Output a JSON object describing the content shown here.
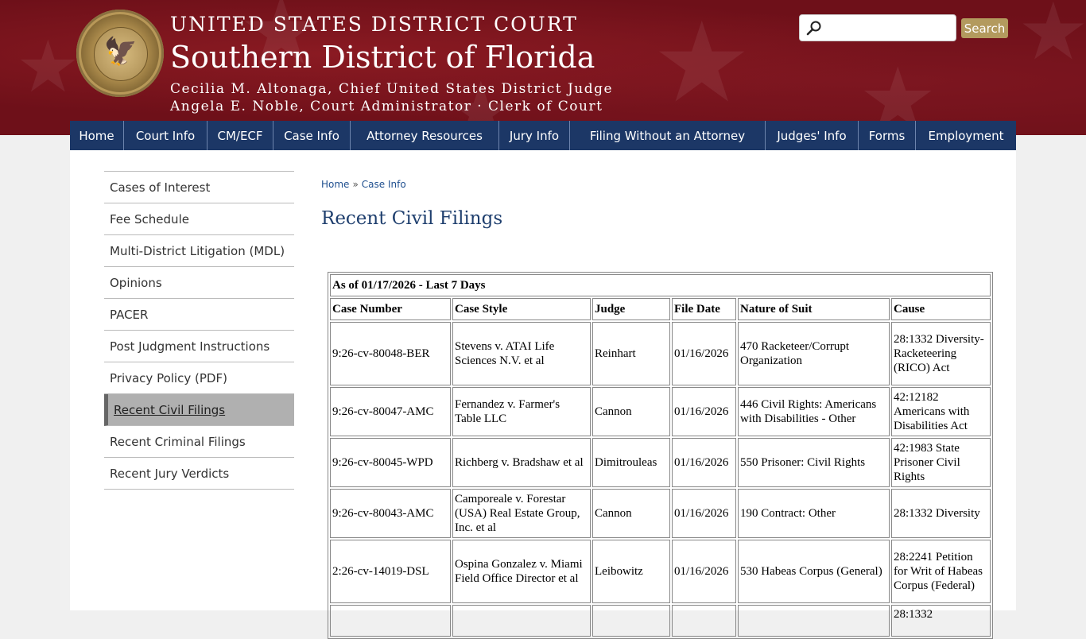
{
  "header": {
    "court_name": "UNITED STATES DISTRICT COURT",
    "district": "Southern District of Florida",
    "chief_judge": "Cecilia M. Altonaga, Chief United States District Judge",
    "administrator": "Angela E. Noble, Court Administrator · Clerk of Court",
    "seal_alt": "court-seal"
  },
  "search": {
    "placeholder": "",
    "button_label": "Search"
  },
  "nav": [
    {
      "label": "Home"
    },
    {
      "label": "Court Info"
    },
    {
      "label": "CM/ECF"
    },
    {
      "label": "Case Info"
    },
    {
      "label": "Attorney Resources"
    },
    {
      "label": "Jury Info"
    },
    {
      "label": "Filing Without an Attorney"
    },
    {
      "label": "Judges' Info"
    },
    {
      "label": "Forms"
    },
    {
      "label": "Employment"
    }
  ],
  "sidebar": [
    {
      "label": "Cases of Interest"
    },
    {
      "label": "Fee Schedule"
    },
    {
      "label": "Multi-District Litigation (MDL)"
    },
    {
      "label": "Opinions"
    },
    {
      "label": "PACER"
    },
    {
      "label": "Post Judgment Instructions"
    },
    {
      "label": "Privacy Policy (PDF)"
    },
    {
      "label": "Recent Civil Filings",
      "active": true
    },
    {
      "label": "Recent Criminal Filings"
    },
    {
      "label": "Recent Jury Verdicts"
    }
  ],
  "breadcrumb": {
    "home": "Home",
    "sep": "»",
    "current": "Case Info"
  },
  "page_title": "Recent Civil Filings",
  "table": {
    "caption": "As of 01/17/2026 - Last 7 Days",
    "headers": [
      "Case Number",
      "Case Style",
      "Judge",
      "File Date",
      "Nature of Suit",
      "Cause"
    ],
    "rows": [
      [
        "9:26-cv-80048-BER",
        "Stevens v. ATAI Life Sciences N.V. et al",
        "Reinhart",
        "01/16/2026",
        "470 Racketeer/Corrupt Organization",
        "28:1332 Diversity-Racketeering (RICO) Act"
      ],
      [
        "9:26-cv-80047-AMC",
        "Fernandez v. Farmer's Table LLC",
        "Cannon",
        "01/16/2026",
        "446 Civil Rights: Americans with Disabilities - Other",
        "42:12182 Americans with Disabilities Act"
      ],
      [
        "9:26-cv-80045-WPD",
        "Richberg v. Bradshaw et al",
        "Dimitrouleas",
        "01/16/2026",
        "550 Prisoner: Civil Rights",
        "42:1983 State Prisoner Civil Rights"
      ],
      [
        "9:26-cv-80043-AMC",
        "Camporeale v. Forestar (USA) Real Estate Group, Inc. et al",
        "Cannon",
        "01/16/2026",
        "190 Contract: Other",
        "28:1332 Diversity"
      ],
      [
        "2:26-cv-14019-DSL",
        "Ospina Gonzalez v. Miami Field Office Director et al",
        "Leibowitz",
        "01/16/2026",
        "530 Habeas Corpus (General)",
        "28:2241 Petition for Writ of Habeas Corpus (Federal)"
      ],
      [
        "",
        "",
        "",
        "",
        "",
        "28:1332"
      ]
    ]
  }
}
